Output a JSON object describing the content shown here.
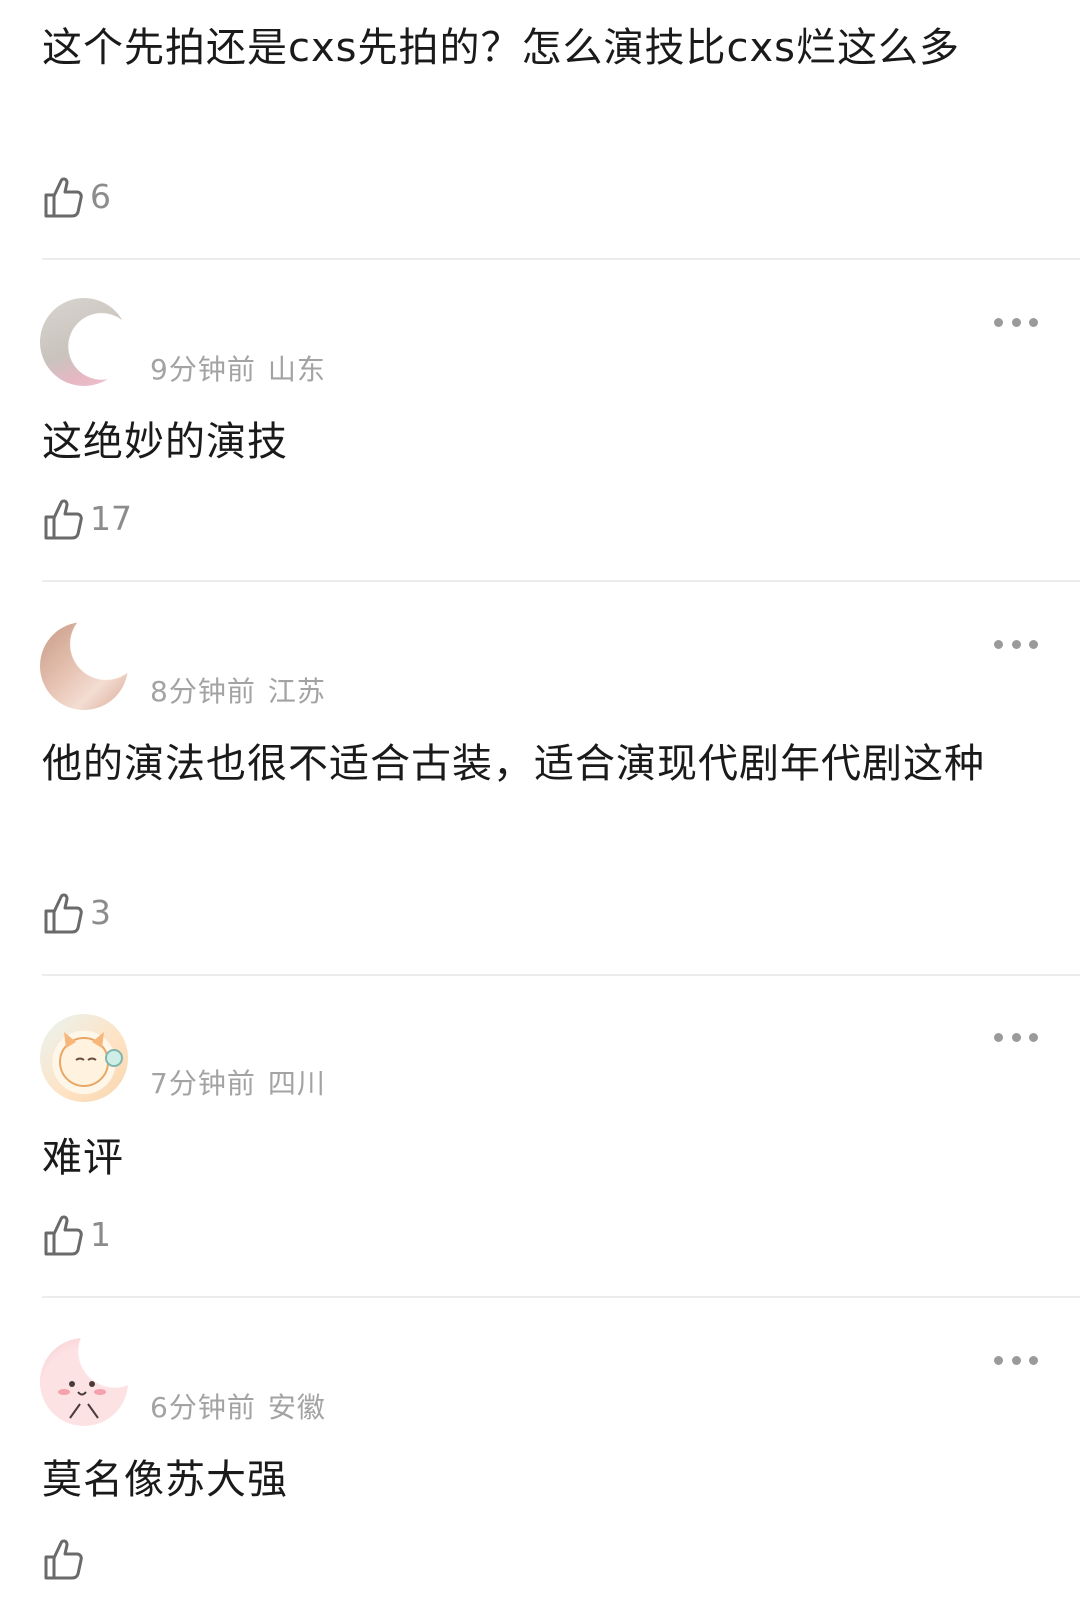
{
  "comments": [
    {
      "text": "这个先拍还是cxs先拍的？怎么演技比cxs烂这么多",
      "likes": "6"
    },
    {
      "time": "9分钟前",
      "location": "山东",
      "text": "这绝妙的演技",
      "likes": "17"
    },
    {
      "time": "8分钟前",
      "location": "江苏",
      "text": "他的演法也很不适合古装，适合演现代剧年代剧这种",
      "likes": "3"
    },
    {
      "time": "7分钟前",
      "location": "四川",
      "text": "难评",
      "likes": "1"
    },
    {
      "time": "6分钟前",
      "location": "安徽",
      "text": "莫名像苏大强",
      "likes": ""
    }
  ],
  "icons": {
    "like": "thumbs-up-icon",
    "more": "more-options-icon"
  },
  "colors": {
    "text": "#1a1a1a",
    "meta": "#a3a3a3",
    "like_count": "#8c8c8c",
    "divider": "#ececec"
  }
}
